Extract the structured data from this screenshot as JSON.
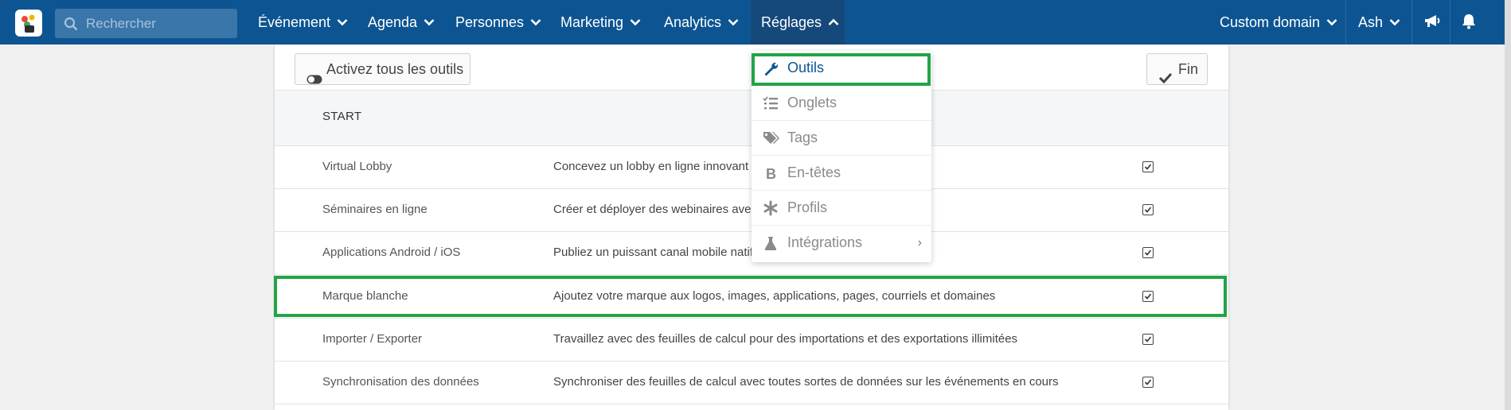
{
  "colors": {
    "nav_bg": "#0d5592",
    "nav_active": "#16497b",
    "highlight": "#22a447",
    "link": "#0d5592"
  },
  "topbar": {
    "search_placeholder": "Rechercher",
    "nav": [
      {
        "label": "Événement"
      },
      {
        "label": "Agenda"
      },
      {
        "label": "Personnes"
      },
      {
        "label": "Marketing"
      },
      {
        "label": "Analytics"
      },
      {
        "label": "Réglages"
      }
    ],
    "custom_domain": "Custom domain",
    "user": "Ash",
    "icons": [
      "megaphone-icon",
      "bell-icon"
    ]
  },
  "toolbar": {
    "activate_label": "Activez tous les outils",
    "fin_label": "Fin"
  },
  "table": {
    "header": "START",
    "rows": [
      {
        "name": "Virtual Lobby",
        "desc": "Concevez un lobby en ligne innovant p",
        "checked": true
      },
      {
        "name": "Séminaires en ligne",
        "desc": "Créer et déployer des webinaires avec",
        "checked": true
      },
      {
        "name": "Applications Android / iOS",
        "desc": "Publiez un puissant canal mobile natif",
        "checked": true
      },
      {
        "name": "Marque blanche",
        "desc": "Ajoutez votre marque aux logos, images, applications, pages, courriels et domaines",
        "checked": true
      },
      {
        "name": "Importer / Exporter",
        "desc": "Travaillez avec des feuilles de calcul pour des importations et des exportations illimitées",
        "checked": true
      },
      {
        "name": "Synchronisation des données",
        "desc": "Synchroniser des feuilles de calcul avec toutes sortes de données sur les événements en cours",
        "checked": true
      }
    ]
  },
  "dropdown": {
    "items": [
      {
        "label": "Outils",
        "icon": "wrench-icon"
      },
      {
        "label": "Onglets",
        "icon": "list-check-icon"
      },
      {
        "label": "Tags",
        "icon": "tags-icon"
      },
      {
        "label": "En-têtes",
        "icon": "bold-icon"
      },
      {
        "label": "Profils",
        "icon": "asterisk-icon"
      },
      {
        "label": "Intégrations",
        "icon": "flask-icon",
        "caret": "›"
      }
    ]
  }
}
